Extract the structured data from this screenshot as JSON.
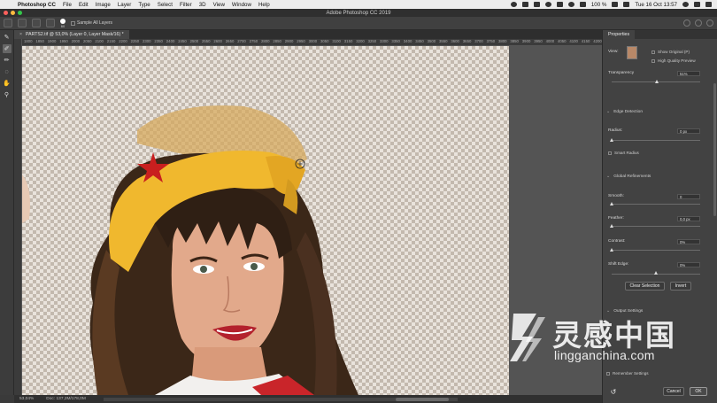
{
  "menubar": {
    "app_name": "Photoshop CC",
    "items": [
      "File",
      "Edit",
      "Image",
      "Layer",
      "Type",
      "Select",
      "Filter",
      "3D",
      "View",
      "Window",
      "Help"
    ],
    "battery": "100 %",
    "datetime": "Tue 16 Oct 13:57"
  },
  "window": {
    "title": "Adobe Photoshop CC 2019"
  },
  "options": {
    "brush_size": "60",
    "sample_all_layers": "Sample All Layers"
  },
  "document": {
    "tab_label": "PARTS2.tif @ 53,0% (Layer 0, Layer Mask/16) *",
    "ruler_ticks": [
      "1800",
      "1850",
      "1900",
      "1950",
      "2000",
      "2050",
      "2100",
      "2150",
      "2200",
      "2250",
      "2300",
      "2350",
      "2400",
      "2450",
      "2500",
      "2550",
      "2600",
      "2650",
      "2700",
      "2750",
      "2800",
      "2850",
      "2900",
      "2950",
      "3000",
      "3050",
      "3100",
      "3150",
      "3200",
      "3250",
      "3300",
      "3350",
      "3400",
      "3450",
      "3500",
      "3550",
      "3600",
      "3650",
      "3700",
      "3750",
      "3800",
      "3850",
      "3900",
      "3950",
      "4000",
      "4050",
      "4100",
      "4150",
      "4200"
    ]
  },
  "status": {
    "zoom": "53,04%",
    "doc_size": "Doc: 137,2M/178,0M"
  },
  "properties": {
    "tab": "Properties",
    "view_label": "View:",
    "show_original": "Show Original (P)",
    "high_quality_preview": "High Quality Preview",
    "transparency_label": "Transparency",
    "transparency_value": "51%",
    "transparency_level": 0.51,
    "edge_detection": "Edge Detection",
    "radius_label": "Radius:",
    "radius_value": "0 px",
    "radius_level": 0.0,
    "smart_radius": "Smart Radius",
    "global_refinements": "Global Refinements",
    "smooth_label": "Smooth:",
    "smooth_value": "0",
    "smooth_level": 0.0,
    "feather_label": "Feather:",
    "feather_value": "0,0 px",
    "feather_level": 0.0,
    "contrast_label": "Contrast:",
    "contrast_value": "0%",
    "contrast_level": 0.0,
    "shift_edge_label": "Shift Edge:",
    "shift_edge_value": "0%",
    "shift_edge_level": 0.5,
    "clear_selection": "Clear Selection",
    "invert": "Invert",
    "output_settings": "Output Settings",
    "remember_settings": "Remember Settings",
    "cancel": "Cancel",
    "ok": "OK"
  },
  "watermark": {
    "chinese": "灵感中国",
    "domain": "lingganchina.com"
  }
}
